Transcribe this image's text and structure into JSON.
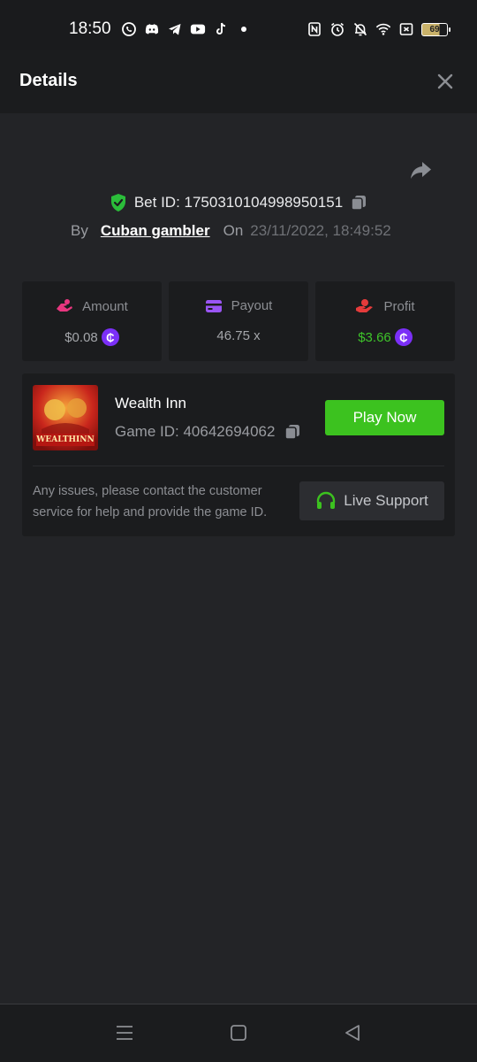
{
  "status_bar": {
    "time": "18:50",
    "battery_level": "69",
    "notification_icons": [
      "whatsapp-icon",
      "discord-icon",
      "telegram-icon",
      "youtube-icon",
      "tiktok-icon",
      "dot-icon"
    ],
    "system_icons": [
      "nfc-icon",
      "alarm-icon",
      "bell-muted-icon",
      "wifi-icon",
      "sim-off-icon",
      "battery-icon"
    ]
  },
  "header": {
    "title": "Details",
    "close_icon": "close-icon"
  },
  "bet": {
    "id_label": "Bet ID: 1750310104998950151",
    "by_label": "By",
    "username": "Cuban gambler",
    "on_label": "On",
    "date": "23/11/2022, 18:49:52"
  },
  "stats": {
    "amount": {
      "label": "Amount",
      "value": "$0.08",
      "icon": "amount-icon"
    },
    "payout": {
      "label": "Payout",
      "value": "46.75 x",
      "icon": "payout-icon"
    },
    "profit": {
      "label": "Profit",
      "value": "$3.66",
      "icon": "profit-icon"
    },
    "coin_symbol": "₵"
  },
  "game": {
    "name": "Wealth Inn",
    "id_label": "Game ID: 40642694062",
    "thumb_text": "WEALTHINN",
    "play_label": "Play Now",
    "help_text": "Any issues, please contact the customer service for help and provide the game ID.",
    "support_label": "Live Support"
  },
  "colors": {
    "background": "#232427",
    "card": "#1b1c1e",
    "accent_green": "#3cc21f",
    "coin_purple": "#7b2ff7",
    "profit_green": "#3ec42a"
  }
}
